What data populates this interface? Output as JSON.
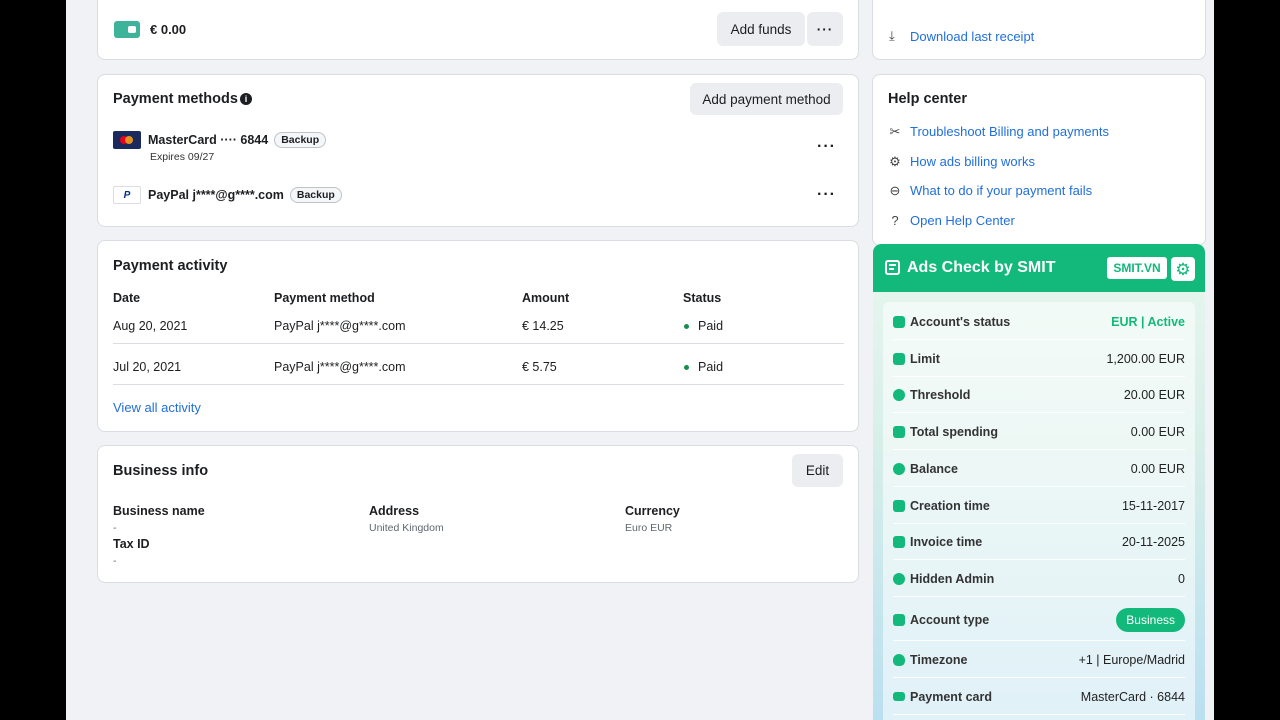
{
  "funds": {
    "amount": "€ 0.00",
    "add_funds_label": "Add funds",
    "more": "···"
  },
  "receipt": {
    "label": "Download last receipt"
  },
  "payment_methods": {
    "title": "Payment methods",
    "add_label": "Add payment method",
    "items": [
      {
        "name": "MasterCard ···· 6844",
        "badge": "Backup",
        "sub": "Expires 09/27"
      },
      {
        "name": "PayPal j****@g****.com",
        "badge": "Backup",
        "sub": ""
      }
    ]
  },
  "help": {
    "title": "Help center",
    "items": [
      {
        "label": "Troubleshoot Billing and payments",
        "icon": "tools-icon"
      },
      {
        "label": "How ads billing works",
        "icon": "gear-circle-icon"
      },
      {
        "label": "What to do if your payment fails",
        "icon": "minus-circle-icon"
      },
      {
        "label": "Open Help Center",
        "icon": "question-circle-icon"
      }
    ]
  },
  "activity": {
    "title": "Payment activity",
    "headers": [
      "Date",
      "Payment method",
      "Amount",
      "Status"
    ],
    "rows": [
      [
        "Aug 20, 2021",
        "PayPal j****@g****.com",
        "€ 14.25",
        "Paid"
      ],
      [
        "Jul 20, 2021",
        "PayPal j****@g****.com",
        "€ 5.75",
        "Paid"
      ]
    ],
    "view_all": "View all activity",
    "status_color": "#1a8c4e"
  },
  "business": {
    "title": "Business info",
    "edit_label": "Edit",
    "business_name_label": "Business name",
    "business_name_value": "-",
    "address_label": "Address",
    "address_value": "United Kingdom",
    "currency_label": "Currency",
    "currency_value": "Euro EUR",
    "tax_label": "Tax ID",
    "tax_value": "-"
  },
  "smit": {
    "title": "Ads Check by SMIT",
    "badge": "SMIT.VN",
    "accent": "#12b97a",
    "rows": [
      {
        "label": "Account's status",
        "value": "EUR | Active"
      },
      {
        "label": "Limit",
        "value": "1,200.00 EUR"
      },
      {
        "label": "Threshold",
        "value": "20.00 EUR"
      },
      {
        "label": "Total spending",
        "value": "0.00 EUR"
      },
      {
        "label": "Balance",
        "value": "0.00 EUR"
      },
      {
        "label": "Creation time",
        "value": "15-11-2017"
      },
      {
        "label": "Invoice time",
        "value": "20-11-2025"
      },
      {
        "label": "Hidden Admin",
        "value": "0"
      },
      {
        "label": "Account type",
        "value": "Business"
      },
      {
        "label": "Timezone",
        "value": "+1 | Europe/Madrid"
      },
      {
        "label": "Payment card",
        "value": "MasterCard · 6844"
      }
    ]
  }
}
